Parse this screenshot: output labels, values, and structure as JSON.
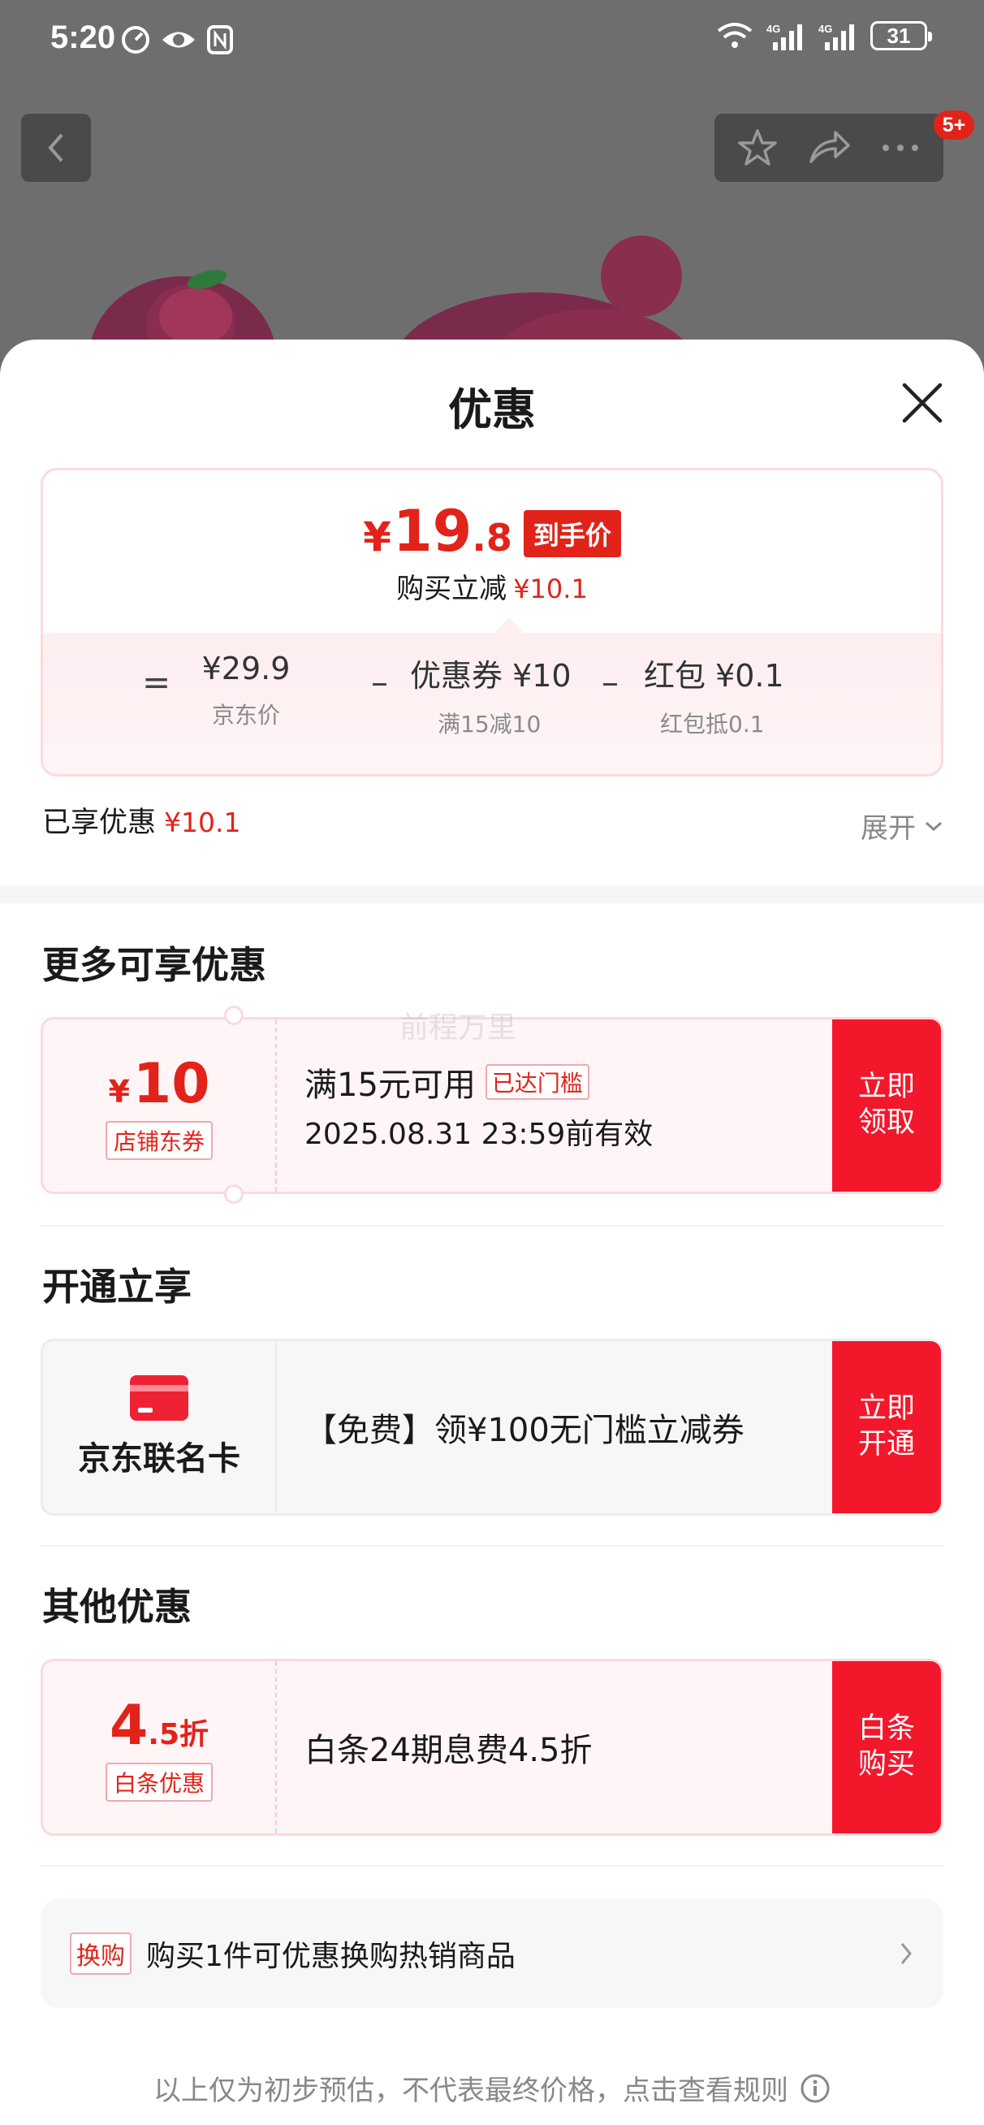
{
  "status_bar": {
    "time": "5:20",
    "battery": "31"
  },
  "nav": {
    "badge": "5+"
  },
  "sheet": {
    "title": "优惠"
  },
  "price_card": {
    "yen": "¥",
    "price_int": "19",
    "price_dec": ".8",
    "price_tag": "到手价",
    "sub_label": "购买立减",
    "sub_value": "¥10.1",
    "calc": {
      "eq": "=",
      "minus": "–",
      "items": [
        {
          "value": "¥29.9",
          "label": "京东价"
        },
        {
          "value": "优惠券 ¥10",
          "label": "满15减10"
        },
        {
          "value": "红包 ¥0.1",
          "label": "红包抵0.1"
        }
      ]
    }
  },
  "enjoyed": {
    "label": "已享优惠",
    "value": "¥10.1",
    "expand": "展开"
  },
  "section_more": {
    "title": "更多可享优惠",
    "coupon": {
      "yen": "¥",
      "amount": "10",
      "tag": "店铺东券",
      "line1": "满15元可用",
      "badge": "已达门槛",
      "line2": "2025.08.31 23:59前有效",
      "button": "立即领取"
    },
    "watermark": "前程万里"
  },
  "section_open": {
    "title": "开通立享",
    "card_name": "京东联名卡",
    "text": "【免费】领¥100无门槛立减券",
    "button": "立即开通"
  },
  "section_other": {
    "title": "其他优惠",
    "amount_big": "4",
    "amount_small": ".5折",
    "tag": "白条优惠",
    "text": "白条24期息费4.5折",
    "button": "白条购买"
  },
  "exchange": {
    "tag": "换购",
    "text": "购买1件可优惠换购热销商品"
  },
  "footer": {
    "note": "以上仅为初步预估，不代表最终价格，点击查看规则"
  },
  "colors": {
    "accent": "#e2231a",
    "button": "#f3172c"
  }
}
